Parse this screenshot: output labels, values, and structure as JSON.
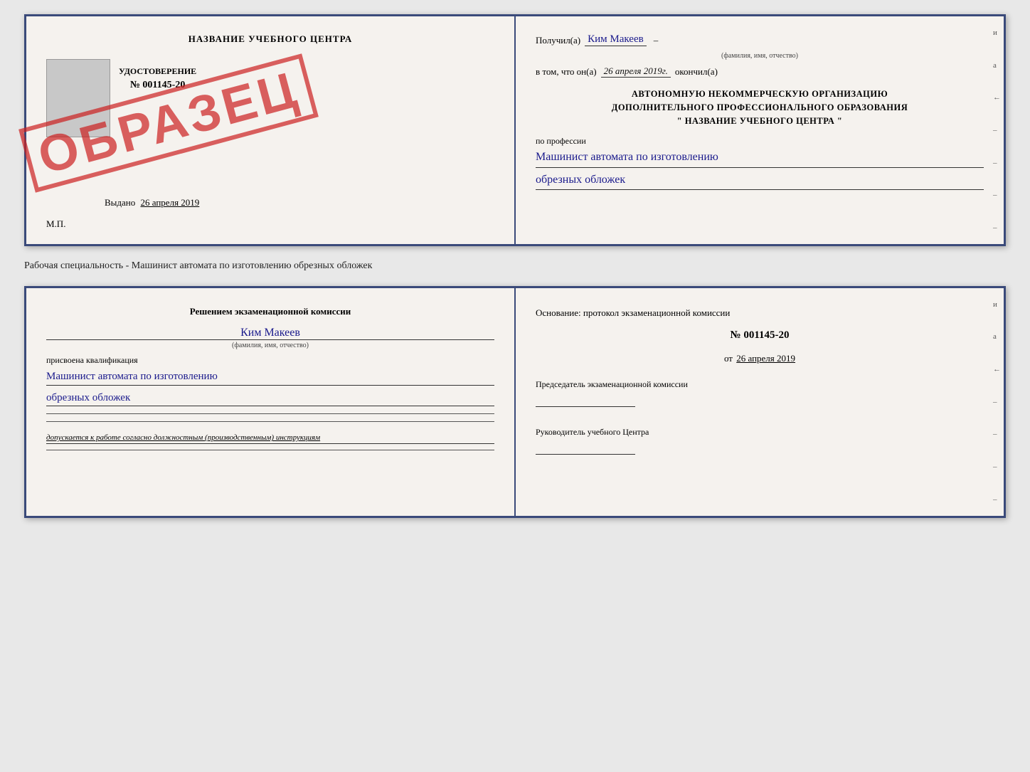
{
  "top_doc": {
    "left": {
      "title": "НАЗВАНИЕ УЧЕБНОГО ЦЕНТРА",
      "stamp_text": "ОБРАЗЕЦ",
      "udostoverenie_label": "УДОСТОВЕРЕНИЕ",
      "number": "№ 001145-20",
      "vydano_label": "Выдано",
      "vydano_date": "26 апреля 2019",
      "mp_label": "М.П."
    },
    "right": {
      "poluchil_label": "Получил(а)",
      "recipient_name": "Ким Макеев",
      "name_sublabel": "(фамилия, имя, отчество)",
      "vtom_prefix": "в том, что он(а)",
      "vtom_date": "26 апреля 2019г.",
      "okonchil_label": "окончил(а)",
      "org_line1": "АВТОНОМНУЮ НЕКОММЕРЧЕСКУЮ ОРГАНИЗАЦИЮ",
      "org_line2": "ДОПОЛНИТЕЛЬНОГО ПРОФЕССИОНАЛЬНОГО ОБРАЗОВАНИЯ",
      "org_line3": "\"  НАЗВАНИЕ УЧЕБНОГО ЦЕНТРА  \"",
      "po_professii_label": "по профессии",
      "profession_line1": "Машинист автомата по изготовлению",
      "profession_line2": "обрезных обложек",
      "right_marks": [
        "и",
        "а",
        "←",
        "–",
        "–",
        "–",
        "–"
      ]
    }
  },
  "middle": {
    "text": "Рабочая специальность - Машинист автомата по изготовлению обрезных обложек"
  },
  "bottom_doc": {
    "left": {
      "resheniem_label": "Решением экзаменационной комиссии",
      "name_handwritten": "Ким Макеев",
      "name_sublabel": "(фамилия, имя, отчество)",
      "prisvoena_label": "присвоена квалификация",
      "profession_line1": "Машинист автомата по изготовлению",
      "profession_line2": "обрезных обложек",
      "dopuskaetsya": "допускается к работе согласно должностным (производственным) инструкциям"
    },
    "right": {
      "osnovanie_label": "Основание: протокол экзаменационной комиссии",
      "number": "№  001145-20",
      "date_prefix": "от",
      "date": "26 апреля 2019",
      "predsedatel_label": "Председатель экзаменационной комиссии",
      "rukovoditel_label": "Руководитель учебного Центра",
      "right_marks": [
        "и",
        "а",
        "←",
        "–",
        "–",
        "–",
        "–"
      ]
    }
  }
}
